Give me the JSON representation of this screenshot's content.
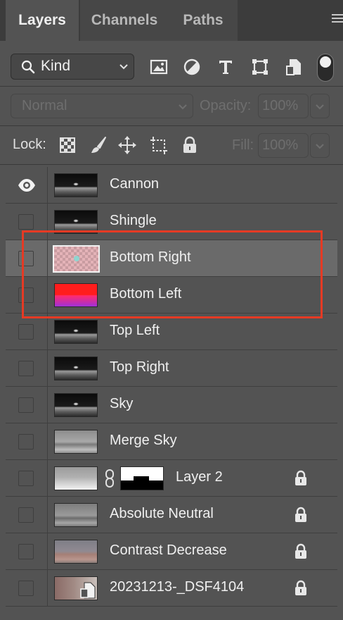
{
  "tabs": [
    {
      "label": "Layers",
      "active": true
    },
    {
      "label": "Channels",
      "active": false
    },
    {
      "label": "Paths",
      "active": false
    }
  ],
  "filter": {
    "kind_label": "Kind",
    "icons": [
      "image-filter-icon",
      "adjustment-filter-icon",
      "type-filter-icon",
      "shape-filter-icon",
      "smart-object-filter-icon"
    ]
  },
  "blend": {
    "mode": "Normal",
    "opacity_label": "Opacity:",
    "opacity_value": "100%",
    "fill_label": "Fill:",
    "fill_value": "100%"
  },
  "lock": {
    "label": "Lock:",
    "icons": [
      "lock-transparent-pixels-icon",
      "lock-image-pixels-icon",
      "lock-position-icon",
      "lock-artboard-icon",
      "lock-all-icon"
    ]
  },
  "layers": [
    {
      "name": "Cannon",
      "visible": true,
      "selected": false,
      "locked": false,
      "thumb": "dark"
    },
    {
      "name": "Shingle",
      "visible": false,
      "selected": false,
      "locked": false,
      "thumb": "dark"
    },
    {
      "name": "Bottom Right",
      "visible": false,
      "selected": true,
      "locked": false,
      "thumb": "pink"
    },
    {
      "name": "Bottom Left",
      "visible": false,
      "selected": false,
      "locked": false,
      "thumb": "red"
    },
    {
      "name": "Top Left",
      "visible": false,
      "selected": false,
      "locked": false,
      "thumb": "dark"
    },
    {
      "name": "Top Right",
      "visible": false,
      "selected": false,
      "locked": false,
      "thumb": "dark"
    },
    {
      "name": "Sky",
      "visible": false,
      "selected": false,
      "locked": false,
      "thumb": "dark"
    },
    {
      "name": "Merge Sky",
      "visible": false,
      "selected": false,
      "locked": false,
      "thumb": "grey"
    },
    {
      "name": "Layer 2",
      "visible": false,
      "selected": false,
      "locked": true,
      "thumb": "layer2",
      "has_mask": true
    },
    {
      "name": "Absolute Neutral",
      "visible": false,
      "selected": false,
      "locked": true,
      "thumb": "greymid"
    },
    {
      "name": "Contrast Decrease",
      "visible": false,
      "selected": false,
      "locked": true,
      "thumb": "contrast"
    },
    {
      "name": "20231213-_DSF4104",
      "visible": false,
      "selected": false,
      "locked": true,
      "thumb": "photo",
      "smart_object": true
    }
  ],
  "annotation": {
    "color": "#e53a24"
  },
  "colors": {
    "panel": "#535353",
    "selected_row": "#6a6a6a",
    "tab_bar": "#3c3c3c"
  }
}
